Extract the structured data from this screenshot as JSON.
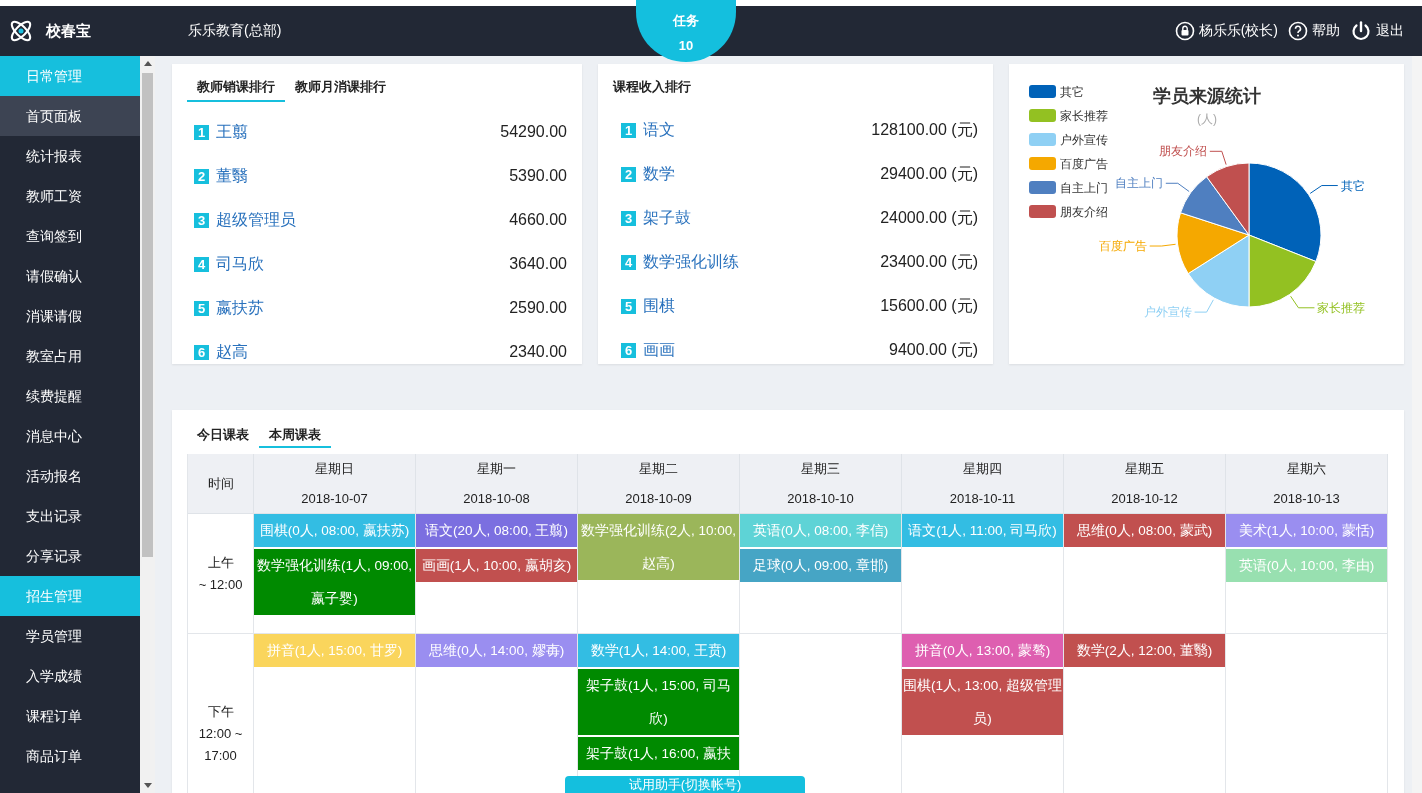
{
  "header": {
    "logo": "校春宝",
    "org": "乐乐教育(总部)",
    "task": {
      "label": "任务",
      "count": "10"
    },
    "user": "杨乐乐(校长)",
    "help": "帮助",
    "logout": "退出"
  },
  "sidebar": [
    {
      "label": "日常管理",
      "kind": "section"
    },
    {
      "label": "首页面板",
      "kind": "item",
      "selected": true
    },
    {
      "label": "统计报表",
      "kind": "item",
      "selected": false
    },
    {
      "label": "教师工资",
      "kind": "item",
      "selected": false
    },
    {
      "label": "查询签到",
      "kind": "item",
      "selected": false
    },
    {
      "label": "请假确认",
      "kind": "item",
      "selected": false
    },
    {
      "label": "消课请假",
      "kind": "item",
      "selected": false
    },
    {
      "label": "教室占用",
      "kind": "item",
      "selected": false
    },
    {
      "label": "续费提醒",
      "kind": "item",
      "selected": false
    },
    {
      "label": "消息中心",
      "kind": "item",
      "selected": false
    },
    {
      "label": "活动报名",
      "kind": "item",
      "selected": false
    },
    {
      "label": "支出记录",
      "kind": "item",
      "selected": false
    },
    {
      "label": "分享记录",
      "kind": "item",
      "selected": false
    },
    {
      "label": "招生管理",
      "kind": "section"
    },
    {
      "label": "学员管理",
      "kind": "item",
      "selected": false
    },
    {
      "label": "入学成绩",
      "kind": "item",
      "selected": false
    },
    {
      "label": "课程订单",
      "kind": "item",
      "selected": false
    },
    {
      "label": "商品订单",
      "kind": "item",
      "selected": false
    }
  ],
  "teacher_rank": {
    "tabs": [
      {
        "label": "教师销课排行",
        "selected": true
      },
      {
        "label": "教师月消课排行",
        "selected": false
      }
    ],
    "rows": [
      {
        "rank": "1",
        "name": "王翦",
        "value": "54290.00"
      },
      {
        "rank": "2",
        "name": "董翳",
        "value": "5390.00"
      },
      {
        "rank": "3",
        "name": "超级管理员",
        "value": "4660.00"
      },
      {
        "rank": "4",
        "name": "司马欣",
        "value": "3640.00"
      },
      {
        "rank": "5",
        "name": "嬴扶苏",
        "value": "2590.00"
      },
      {
        "rank": "6",
        "name": "赵高",
        "value": "2340.00"
      }
    ]
  },
  "course_rank": {
    "title": "课程收入排行",
    "rows": [
      {
        "rank": "1",
        "name": "语文",
        "value": "128100.00 (元)"
      },
      {
        "rank": "2",
        "name": "数学",
        "value": "29400.00 (元)"
      },
      {
        "rank": "3",
        "name": "架子鼓",
        "value": "24000.00 (元)"
      },
      {
        "rank": "4",
        "name": "数学强化训练",
        "value": "23400.00 (元)"
      },
      {
        "rank": "5",
        "name": "围棋",
        "value": "15600.00 (元)"
      },
      {
        "rank": "6",
        "name": "画画",
        "value": "9400.00 (元)"
      }
    ]
  },
  "source_chart": {
    "title": "学员来源统计",
    "subtitle": "(人)",
    "sources": [
      {
        "legend": "其它",
        "label": "其它",
        "color": "#0062b8"
      },
      {
        "legend": "家长推荐",
        "label": "家长推荐",
        "color": "#93c122"
      },
      {
        "legend": "户外宣传",
        "label": "户外宣传",
        "color": "#8fd0f4"
      },
      {
        "legend": "百度广告",
        "label": "百度广告",
        "color": "#f5a800"
      },
      {
        "legend": "自主上门",
        "label": "自主上门",
        "color": "#4f7fc0"
      },
      {
        "legend": "朋友介绍",
        "label": "朋友介绍",
        "color": "#c0504f"
      }
    ]
  },
  "schedule": {
    "tabs": [
      {
        "label": "今日课表",
        "selected": false
      },
      {
        "label": "本周课表",
        "selected": true
      }
    ],
    "time_header": "时间",
    "days": [
      {
        "weekday": "星期日",
        "date": "2018-10-07"
      },
      {
        "weekday": "星期一",
        "date": "2018-10-08"
      },
      {
        "weekday": "星期二",
        "date": "2018-10-09"
      },
      {
        "weekday": "星期三",
        "date": "2018-10-10"
      },
      {
        "weekday": "星期四",
        "date": "2018-10-11"
      },
      {
        "weekday": "星期五",
        "date": "2018-10-12"
      },
      {
        "weekday": "星期六",
        "date": "2018-10-13"
      }
    ],
    "periods": [
      {
        "name": "上午",
        "range": "~ 12:00",
        "cells": [
          [
            {
              "text": "围棋(0人, 08:00, 嬴扶苏)",
              "color": "#33bde3"
            },
            {
              "text": "数学强化训练(1人, 09:00, 嬴子婴)",
              "color": "#008a00"
            }
          ],
          [
            {
              "text": "语文(20人, 08:00, 王翦)",
              "color": "#7b6fe0"
            },
            {
              "text": "画画(1人, 10:00, 嬴胡亥)",
              "color": "#c1504f"
            }
          ],
          [
            {
              "text": "数学强化训练(2人, 10:00, 赵高)",
              "color": "#9bb65a"
            }
          ],
          [
            {
              "text": "英语(0人, 08:00, 李信)",
              "color": "#5ed3d6"
            },
            {
              "text": "足球(0人, 09:00, 章邯)",
              "color": "#46a5c5"
            }
          ],
          [
            {
              "text": "语文(1人, 11:00, 司马欣)",
              "color": "#33bde3"
            }
          ],
          [
            {
              "text": "思维(0人, 08:00, 蒙武)",
              "color": "#c1504f"
            }
          ],
          [
            {
              "text": "美术(1人, 10:00, 蒙恬)",
              "color": "#9a8ef0"
            },
            {
              "text": "英语(0人, 10:00, 李由)",
              "color": "#98e0b0"
            }
          ]
        ]
      },
      {
        "name": "下午",
        "range": "12:00 ~ 17:00",
        "cells": [
          [
            {
              "text": "拼音(1人, 15:00, 甘罗)",
              "color": "#fad55c"
            }
          ],
          [
            {
              "text": "思维(0人, 14:00, 嫪毐)",
              "color": "#9a8ef0"
            }
          ],
          [
            {
              "text": "数学(1人, 14:00, 王贲)",
              "color": "#33bde3"
            },
            {
              "text": "架子鼓(1人, 15:00, 司马欣)",
              "color": "#008a00"
            },
            {
              "text": "架子鼓(1人, 16:00, 嬴扶",
              "color": "#008a00"
            }
          ],
          [],
          [
            {
              "text": "拼音(0人, 13:00, 蒙骜)",
              "color": "#de5fb0"
            },
            {
              "text": "围棋(1人, 13:00, 超级管理员)",
              "color": "#c1504f"
            }
          ],
          [
            {
              "text": "数学(2人, 12:00, 董翳)",
              "color": "#c1504f"
            }
          ],
          []
        ]
      }
    ]
  },
  "assistant_button": "试用助手(切换帐号)"
}
